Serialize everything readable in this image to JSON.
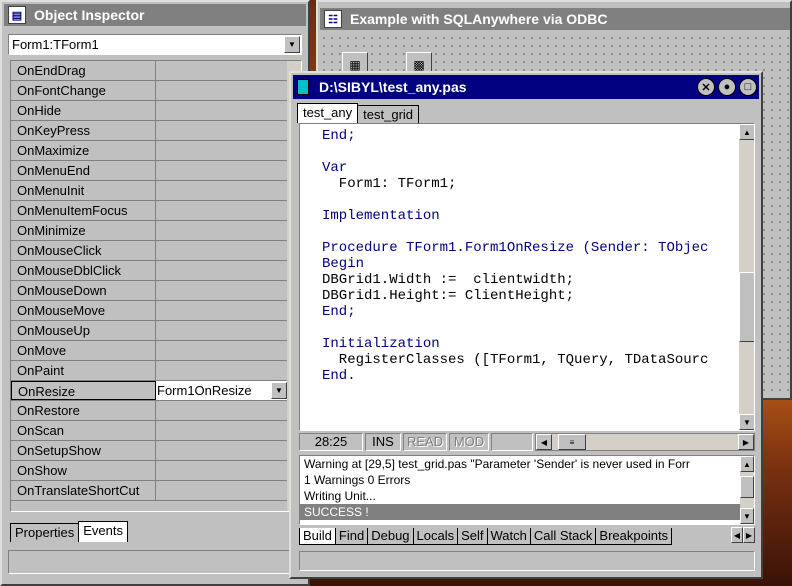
{
  "inspector": {
    "title": "Object Inspector",
    "selected_object": "Form1:TForm1",
    "rows": [
      {
        "name": "OnEndDrag",
        "value": ""
      },
      {
        "name": "OnFontChange",
        "value": ""
      },
      {
        "name": "OnHide",
        "value": ""
      },
      {
        "name": "OnKeyPress",
        "value": ""
      },
      {
        "name": "OnMaximize",
        "value": ""
      },
      {
        "name": "OnMenuEnd",
        "value": ""
      },
      {
        "name": "OnMenuInit",
        "value": ""
      },
      {
        "name": "OnMenuItemFocus",
        "value": ""
      },
      {
        "name": "OnMinimize",
        "value": ""
      },
      {
        "name": "OnMouseClick",
        "value": ""
      },
      {
        "name": "OnMouseDblClick",
        "value": ""
      },
      {
        "name": "OnMouseDown",
        "value": ""
      },
      {
        "name": "OnMouseMove",
        "value": ""
      },
      {
        "name": "OnMouseUp",
        "value": ""
      },
      {
        "name": "OnMove",
        "value": ""
      },
      {
        "name": "OnPaint",
        "value": ""
      },
      {
        "name": "OnResize",
        "value": "Form1OnResize"
      },
      {
        "name": "OnRestore",
        "value": ""
      },
      {
        "name": "OnScan",
        "value": ""
      },
      {
        "name": "OnSetupShow",
        "value": ""
      },
      {
        "name": "OnShow",
        "value": ""
      },
      {
        "name": "OnTranslateShortCut",
        "value": ""
      }
    ],
    "tabs": [
      "Properties",
      "Events"
    ],
    "active_tab": "Events"
  },
  "form_window": {
    "title": "Example with SQLAnywhere via ODBC"
  },
  "editor": {
    "title": "D:\\SIBYL\\test_any.pas",
    "file_tabs": [
      "test_any",
      "test_grid"
    ],
    "active_file_tab": "test_any",
    "code": [
      "End;",
      "",
      "Var",
      "  Form1: TForm1;",
      "",
      "Implementation",
      "",
      "Procedure TForm1.Form1OnResize (Sender: TObjec",
      "Begin",
      "DBGrid1.Width :=  clientwidth;",
      "DBGrid1.Height:= ClientHeight;",
      "End;",
      "",
      "Initialization",
      "  RegisterClasses ([TForm1, TQuery, TDataSourc",
      "End."
    ],
    "status": {
      "position": "28:25",
      "ins": "INS",
      "read": "READ",
      "mod": "MOD"
    },
    "messages": [
      "Warning at [29,5] test_grid.pas  \"Parameter 'Sender' is never used in Forr",
      "1 Warnings   0 Errors",
      "Writing Unit...",
      "SUCCESS !"
    ],
    "message_tabs": [
      "Build",
      "Find",
      "Debug",
      "Locals",
      "Self",
      "Watch",
      "Call Stack",
      "Breakpoints"
    ],
    "active_message_tab": "Build"
  },
  "colors": {
    "active_caption": "#000080",
    "inactive_caption": "#808080",
    "face": "#c0c0c0"
  }
}
